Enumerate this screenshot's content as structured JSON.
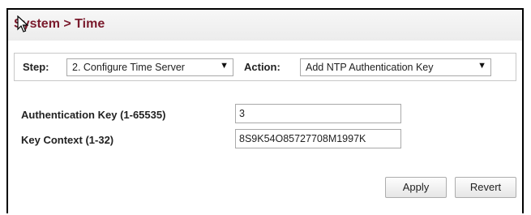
{
  "header": {
    "title": "System > Time"
  },
  "toolbar": {
    "step_label": "Step:",
    "step_value": "2. Configure Time Server",
    "action_label": "Action:",
    "action_value": "Add NTP Authentication Key"
  },
  "form": {
    "auth_key_label": "Authentication Key (1-65535)",
    "auth_key_value": "3",
    "key_context_label": "Key Context (1-32)",
    "key_context_value": "8S9K54O85727708M1997K"
  },
  "buttons": {
    "apply": "Apply",
    "revert": "Revert"
  },
  "icons": {
    "dropdown_arrow": "▼",
    "cursor": "mouse-cursor-icon"
  },
  "colors": {
    "title": "#7a1a2c"
  }
}
